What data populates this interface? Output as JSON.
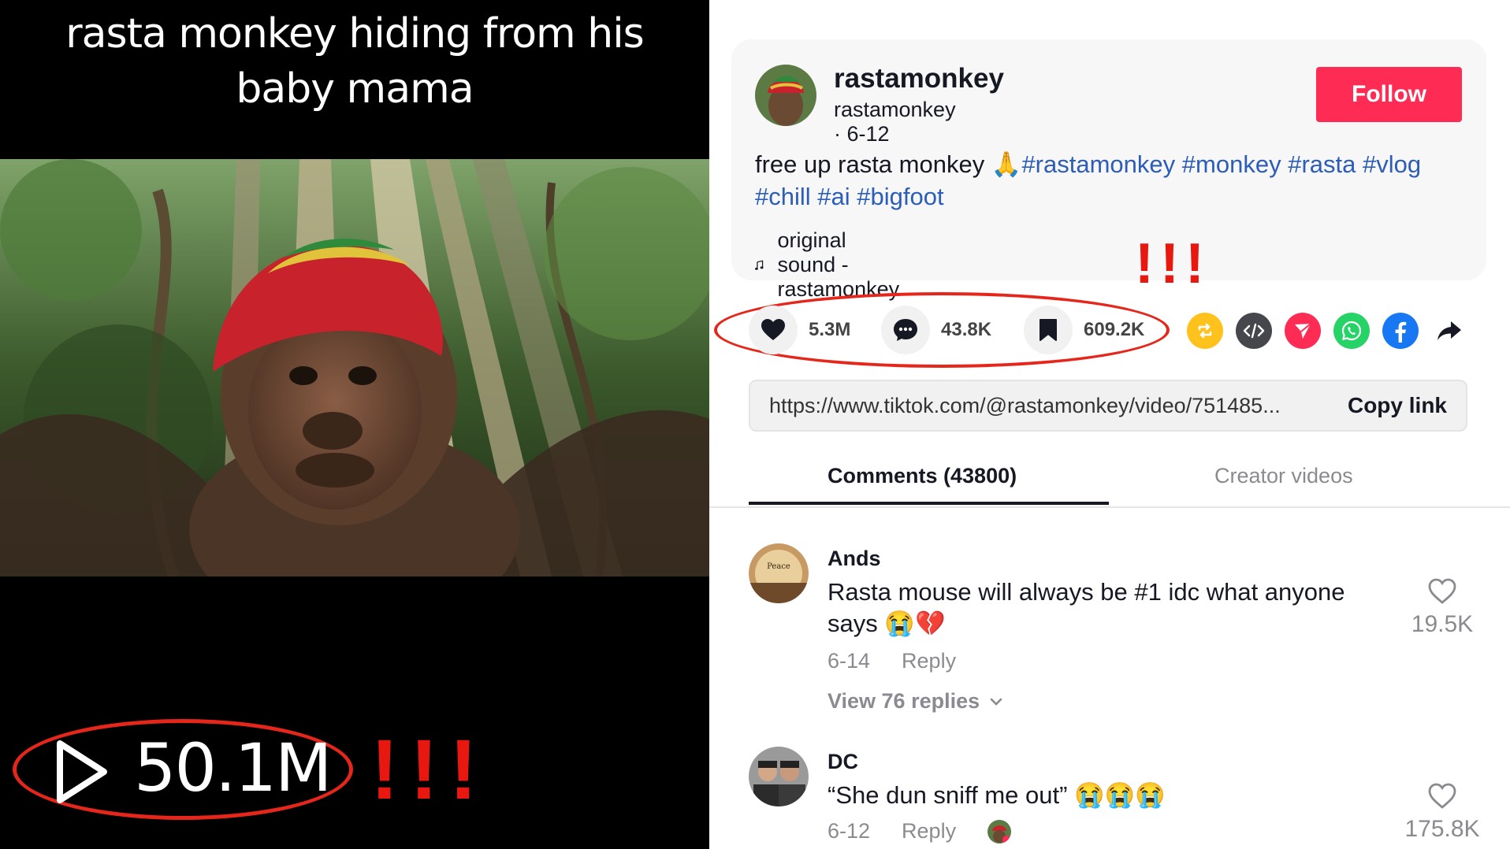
{
  "video": {
    "caption_line1": "rasta monkey hiding from his",
    "caption_line2": "baby mama",
    "play_count": "50.1M",
    "annotation": "!!!"
  },
  "author": {
    "display_name": "rastamonkey",
    "handle": "rastamonkey",
    "date": "6-12",
    "follow_label": "Follow"
  },
  "post": {
    "text": "free up rasta monkey",
    "emoji": "🙏",
    "hashtags": [
      "#rastamonkey",
      "#monkey",
      "#rasta",
      "#vlog",
      "#chill",
      "#ai",
      "#bigfoot"
    ],
    "sound": "original sound - rastamonkey"
  },
  "annotation_small": "!!!",
  "actions": {
    "likes": "5.3M",
    "comments": "43.8K",
    "saves": "609.2K"
  },
  "share_icons": [
    "repost-icon",
    "embed-icon",
    "send-icon",
    "whatsapp-icon",
    "facebook-icon",
    "share-arrow-icon"
  ],
  "link": {
    "url": "https://www.tiktok.com/@rastamonkey/video/751485...",
    "copy_label": "Copy link"
  },
  "tabs": [
    {
      "label": "Comments (43800)",
      "active": true
    },
    {
      "label": "Creator videos",
      "active": false
    }
  ],
  "comments": [
    {
      "name": "Ands",
      "text": "Rasta mouse will always be #1 idc what anyone says 😭💔",
      "date": "6-14",
      "reply_label": "Reply",
      "likes": "19.5K",
      "view_replies": "View 76 replies"
    },
    {
      "name": "DC",
      "text": "“She dun sniff me out” 😭😭😭",
      "date": "6-12",
      "reply_label": "Reply",
      "likes": "175.8K"
    }
  ],
  "colors": {
    "brand": "#fe2c55",
    "hashtag": "#2b5db9",
    "annotation": "#e6261a"
  }
}
